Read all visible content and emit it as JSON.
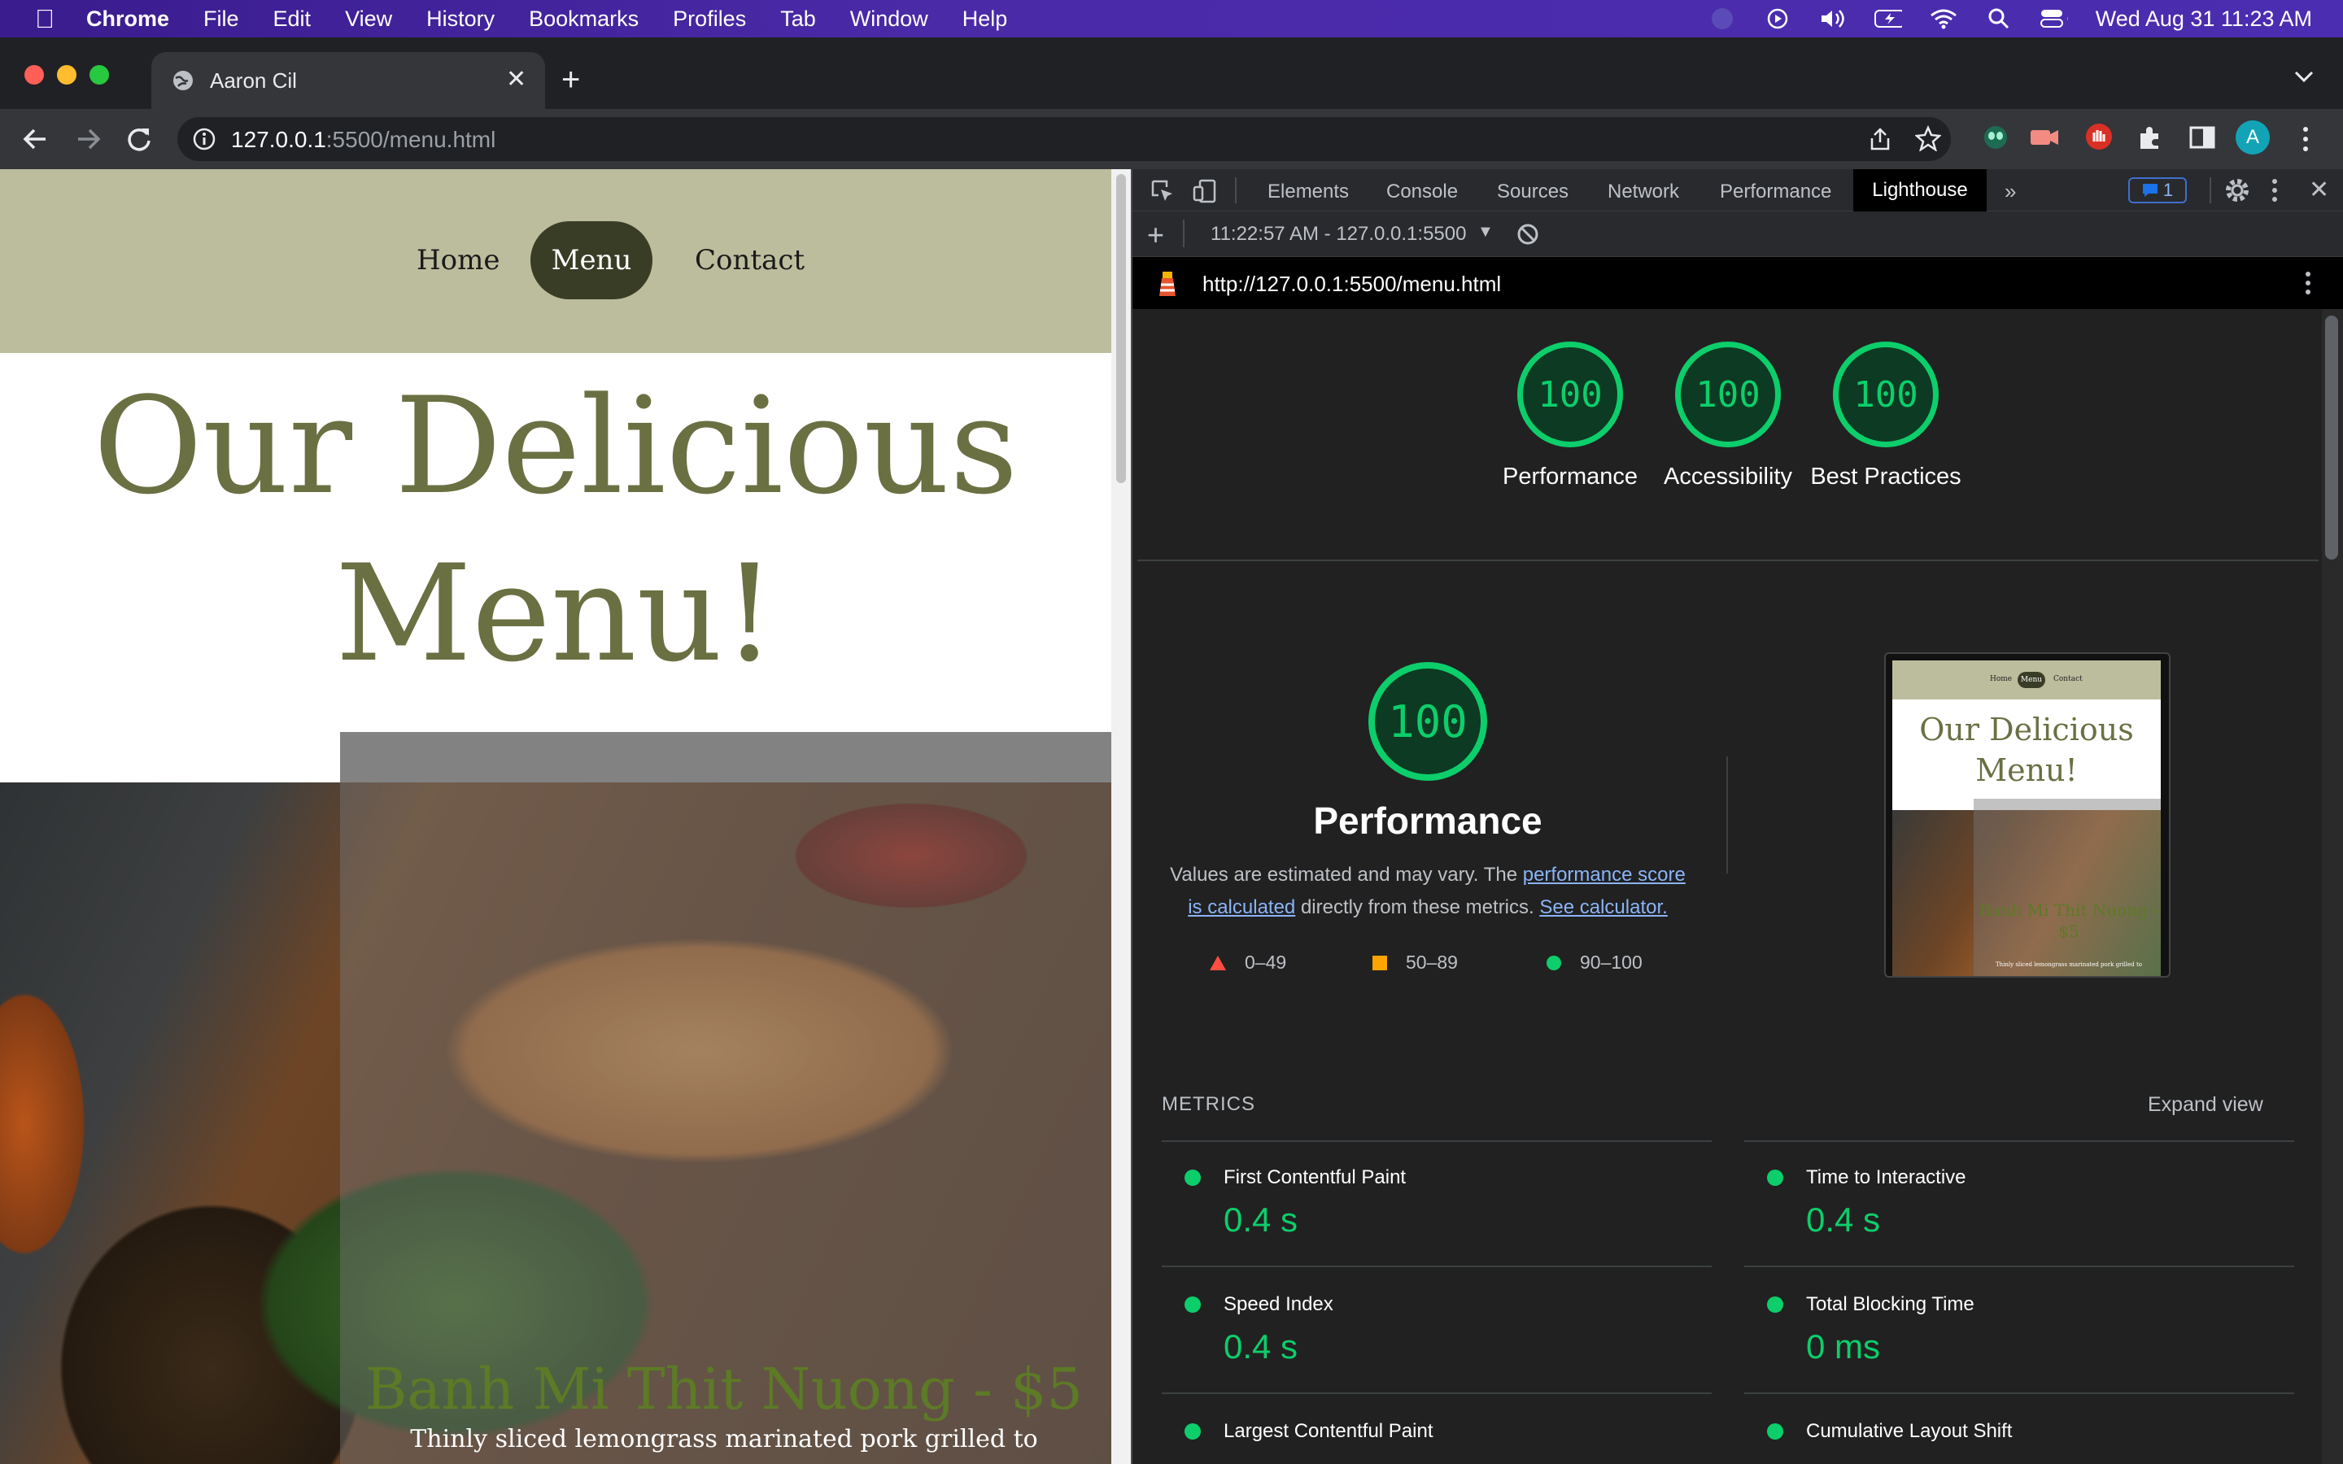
{
  "menubar": {
    "app": "Chrome",
    "items": [
      "File",
      "Edit",
      "View",
      "History",
      "Bookmarks",
      "Profiles",
      "Tab",
      "Window",
      "Help"
    ],
    "clock": "Wed Aug 31  11:23 AM"
  },
  "browser": {
    "tab_title": "Aaron Cil",
    "url_host": "127.0.0.1",
    "url_path": ":5500/menu.html",
    "profile_initial": "A"
  },
  "page": {
    "nav": [
      "Home",
      "Menu",
      "Contact"
    ],
    "heading": "Our Delicious Menu!",
    "dish_title": "Banh Mi Thit Nuong - $5",
    "dish_desc": "Thinly sliced lemongrass marinated pork grilled to"
  },
  "devtools": {
    "tabs": [
      "Elements",
      "Console",
      "Sources",
      "Network",
      "Performance",
      "Lighthouse"
    ],
    "active_tab": "Lighthouse",
    "issues_count": "1",
    "report_select": "11:22:57 AM - 127.0.0.1:5500",
    "report_url": "http://127.0.0.1:5500/menu.html"
  },
  "lighthouse": {
    "scores": [
      {
        "label": "Performance",
        "score": "100"
      },
      {
        "label": "Accessibility",
        "score": "100"
      },
      {
        "label": "Best Practices",
        "score": "100"
      }
    ],
    "performance_score": "100",
    "performance_title": "Performance",
    "desc_pre": "Values are estimated and may vary. The ",
    "desc_link1": "performance score is calculated",
    "desc_mid": " directly from these metrics. ",
    "desc_link2": "See calculator.",
    "legend": [
      {
        "range": "0–49",
        "color": "#ff4e42"
      },
      {
        "range": "50–89",
        "color": "#ffa400"
      },
      {
        "range": "90–100",
        "color": "#0cce6b"
      }
    ],
    "thumbnail": {
      "nav": [
        "Home",
        "Menu",
        "Contact"
      ],
      "heading": "Our Delicious Menu!",
      "dish": "Banh Mi Thit Nuong - $5",
      "desc": "Thinly sliced lemongrass marinated pork grilled to"
    },
    "metrics_heading": "METRICS",
    "expand_label": "Expand view",
    "metrics": [
      {
        "name": "First Contentful Paint",
        "value": "0.4 s"
      },
      {
        "name": "Time to Interactive",
        "value": "0.4 s"
      },
      {
        "name": "Speed Index",
        "value": "0.4 s"
      },
      {
        "name": "Total Blocking Time",
        "value": "0 ms"
      },
      {
        "name": "Largest Contentful Paint",
        "value": ""
      },
      {
        "name": "Cumulative Layout Shift",
        "value": ""
      }
    ]
  },
  "colors": {
    "pass": "#0cce6b",
    "page_olive": "#6b7043",
    "nav_bg": "#bcbd9d"
  }
}
